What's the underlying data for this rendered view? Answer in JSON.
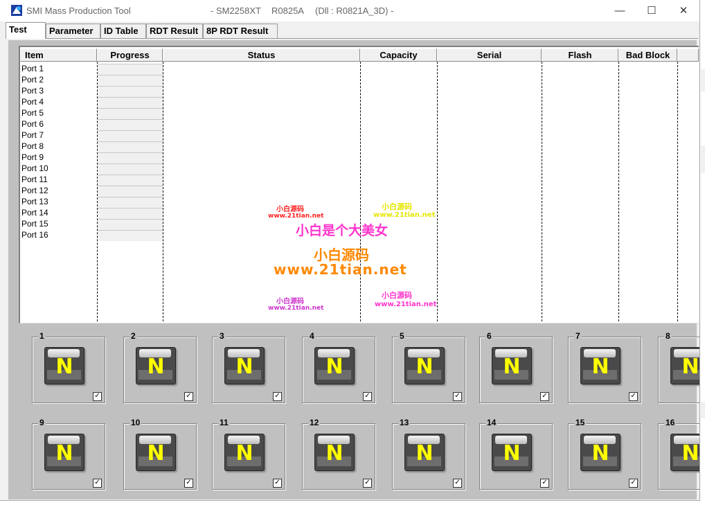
{
  "window": {
    "app_name": "SMI Mass Production Tool",
    "controller": "- SM2258XT",
    "version": "R0825A",
    "dll": "(Dll : R0821A_3D) -",
    "min_glyph": "—",
    "max_glyph": "☐",
    "close_glyph": "✕"
  },
  "tabs": [
    "Test",
    "Parameter",
    "ID Table",
    "RDT Result",
    "8P RDT Result"
  ],
  "columns": [
    "Item",
    "Progress",
    "Status",
    "Capacity",
    "Serial",
    "Flash",
    "Bad Block"
  ],
  "ports": [
    "Port 1",
    "Port 2",
    "Port 3",
    "Port 4",
    "Port 5",
    "Port 6",
    "Port 7",
    "Port 8",
    "Port 9",
    "Port 10",
    "Port 11",
    "Port 12",
    "Port 13",
    "Port 14",
    "Port 15",
    "Port 16"
  ],
  "watermark": {
    "small_cn": "小白源码",
    "small_url": "www.21tian.net",
    "tagline": "小白是个大美女",
    "big_cn": "小白源码",
    "big_url": "www.21tian.net"
  },
  "slots": [
    {
      "num": "1",
      "status": "N",
      "checked": "✓"
    },
    {
      "num": "2",
      "status": "N",
      "checked": "✓"
    },
    {
      "num": "3",
      "status": "N",
      "checked": "✓"
    },
    {
      "num": "4",
      "status": "N",
      "checked": "✓"
    },
    {
      "num": "5",
      "status": "N",
      "checked": "✓"
    },
    {
      "num": "6",
      "status": "N",
      "checked": "✓"
    },
    {
      "num": "7",
      "status": "N",
      "checked": "✓"
    },
    {
      "num": "8",
      "status": "N",
      "checked": "✓"
    },
    {
      "num": "9",
      "status": "N",
      "checked": "✓"
    },
    {
      "num": "10",
      "status": "N",
      "checked": "✓"
    },
    {
      "num": "11",
      "status": "N",
      "checked": "✓"
    },
    {
      "num": "12",
      "status": "N",
      "checked": "✓"
    },
    {
      "num": "13",
      "status": "N",
      "checked": "✓"
    },
    {
      "num": "14",
      "status": "N",
      "checked": "✓"
    },
    {
      "num": "15",
      "status": "N",
      "checked": "✓"
    },
    {
      "num": "16",
      "status": "N",
      "checked": "✓"
    }
  ],
  "colors": {
    "panel_bg": "#c0c0c0",
    "device_letter": "#ffff00",
    "watermark_red": "#ff2222",
    "watermark_pink": "#ff33cc",
    "watermark_yellow": "#e6e600",
    "watermark_orange": "#ff8800"
  }
}
